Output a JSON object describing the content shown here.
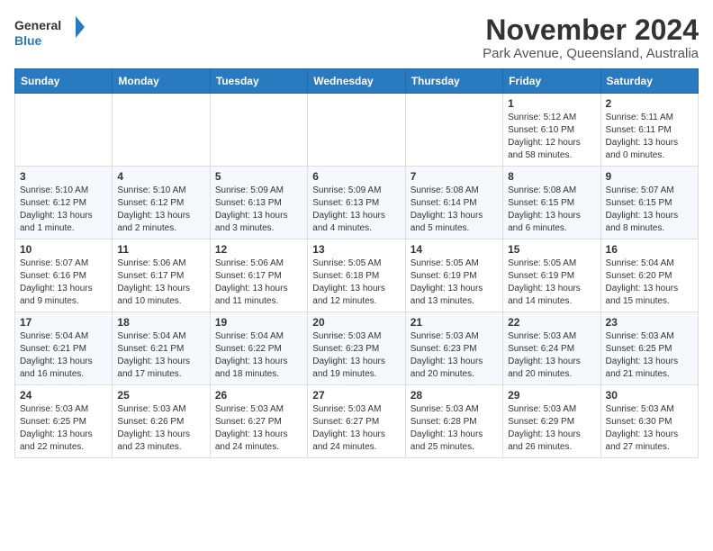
{
  "header": {
    "logo_general": "General",
    "logo_blue": "Blue",
    "month": "November 2024",
    "location": "Park Avenue, Queensland, Australia"
  },
  "weekdays": [
    "Sunday",
    "Monday",
    "Tuesday",
    "Wednesday",
    "Thursday",
    "Friday",
    "Saturday"
  ],
  "weeks": [
    [
      {
        "day": "",
        "info": ""
      },
      {
        "day": "",
        "info": ""
      },
      {
        "day": "",
        "info": ""
      },
      {
        "day": "",
        "info": ""
      },
      {
        "day": "",
        "info": ""
      },
      {
        "day": "1",
        "info": "Sunrise: 5:12 AM\nSunset: 6:10 PM\nDaylight: 12 hours\nand 58 minutes."
      },
      {
        "day": "2",
        "info": "Sunrise: 5:11 AM\nSunset: 6:11 PM\nDaylight: 13 hours\nand 0 minutes."
      }
    ],
    [
      {
        "day": "3",
        "info": "Sunrise: 5:10 AM\nSunset: 6:12 PM\nDaylight: 13 hours\nand 1 minute."
      },
      {
        "day": "4",
        "info": "Sunrise: 5:10 AM\nSunset: 6:12 PM\nDaylight: 13 hours\nand 2 minutes."
      },
      {
        "day": "5",
        "info": "Sunrise: 5:09 AM\nSunset: 6:13 PM\nDaylight: 13 hours\nand 3 minutes."
      },
      {
        "day": "6",
        "info": "Sunrise: 5:09 AM\nSunset: 6:13 PM\nDaylight: 13 hours\nand 4 minutes."
      },
      {
        "day": "7",
        "info": "Sunrise: 5:08 AM\nSunset: 6:14 PM\nDaylight: 13 hours\nand 5 minutes."
      },
      {
        "day": "8",
        "info": "Sunrise: 5:08 AM\nSunset: 6:15 PM\nDaylight: 13 hours\nand 6 minutes."
      },
      {
        "day": "9",
        "info": "Sunrise: 5:07 AM\nSunset: 6:15 PM\nDaylight: 13 hours\nand 8 minutes."
      }
    ],
    [
      {
        "day": "10",
        "info": "Sunrise: 5:07 AM\nSunset: 6:16 PM\nDaylight: 13 hours\nand 9 minutes."
      },
      {
        "day": "11",
        "info": "Sunrise: 5:06 AM\nSunset: 6:17 PM\nDaylight: 13 hours\nand 10 minutes."
      },
      {
        "day": "12",
        "info": "Sunrise: 5:06 AM\nSunset: 6:17 PM\nDaylight: 13 hours\nand 11 minutes."
      },
      {
        "day": "13",
        "info": "Sunrise: 5:05 AM\nSunset: 6:18 PM\nDaylight: 13 hours\nand 12 minutes."
      },
      {
        "day": "14",
        "info": "Sunrise: 5:05 AM\nSunset: 6:19 PM\nDaylight: 13 hours\nand 13 minutes."
      },
      {
        "day": "15",
        "info": "Sunrise: 5:05 AM\nSunset: 6:19 PM\nDaylight: 13 hours\nand 14 minutes."
      },
      {
        "day": "16",
        "info": "Sunrise: 5:04 AM\nSunset: 6:20 PM\nDaylight: 13 hours\nand 15 minutes."
      }
    ],
    [
      {
        "day": "17",
        "info": "Sunrise: 5:04 AM\nSunset: 6:21 PM\nDaylight: 13 hours\nand 16 minutes."
      },
      {
        "day": "18",
        "info": "Sunrise: 5:04 AM\nSunset: 6:21 PM\nDaylight: 13 hours\nand 17 minutes."
      },
      {
        "day": "19",
        "info": "Sunrise: 5:04 AM\nSunset: 6:22 PM\nDaylight: 13 hours\nand 18 minutes."
      },
      {
        "day": "20",
        "info": "Sunrise: 5:03 AM\nSunset: 6:23 PM\nDaylight: 13 hours\nand 19 minutes."
      },
      {
        "day": "21",
        "info": "Sunrise: 5:03 AM\nSunset: 6:23 PM\nDaylight: 13 hours\nand 20 minutes."
      },
      {
        "day": "22",
        "info": "Sunrise: 5:03 AM\nSunset: 6:24 PM\nDaylight: 13 hours\nand 20 minutes."
      },
      {
        "day": "23",
        "info": "Sunrise: 5:03 AM\nSunset: 6:25 PM\nDaylight: 13 hours\nand 21 minutes."
      }
    ],
    [
      {
        "day": "24",
        "info": "Sunrise: 5:03 AM\nSunset: 6:25 PM\nDaylight: 13 hours\nand 22 minutes."
      },
      {
        "day": "25",
        "info": "Sunrise: 5:03 AM\nSunset: 6:26 PM\nDaylight: 13 hours\nand 23 minutes."
      },
      {
        "day": "26",
        "info": "Sunrise: 5:03 AM\nSunset: 6:27 PM\nDaylight: 13 hours\nand 24 minutes."
      },
      {
        "day": "27",
        "info": "Sunrise: 5:03 AM\nSunset: 6:27 PM\nDaylight: 13 hours\nand 24 minutes."
      },
      {
        "day": "28",
        "info": "Sunrise: 5:03 AM\nSunset: 6:28 PM\nDaylight: 13 hours\nand 25 minutes."
      },
      {
        "day": "29",
        "info": "Sunrise: 5:03 AM\nSunset: 6:29 PM\nDaylight: 13 hours\nand 26 minutes."
      },
      {
        "day": "30",
        "info": "Sunrise: 5:03 AM\nSunset: 6:30 PM\nDaylight: 13 hours\nand 27 minutes."
      }
    ]
  ]
}
